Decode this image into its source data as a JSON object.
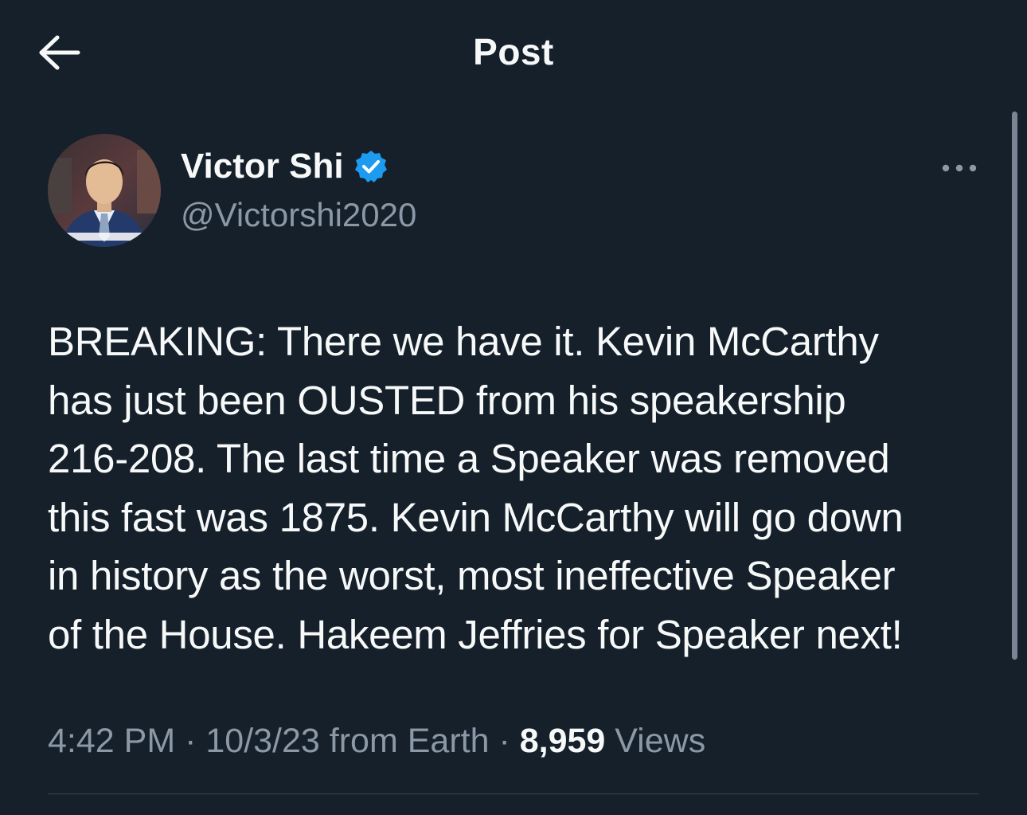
{
  "header": {
    "title": "Post",
    "back_icon": "arrow-left-icon"
  },
  "author": {
    "display_name": "Victor Shi",
    "handle": "@Victorshi2020",
    "verified_icon": "verified-badge-icon",
    "more_icon": "more-horizontal-icon"
  },
  "tweet": {
    "text": "BREAKING: There we have it. Kevin McCarthy\nhas just been OUSTED from his speakership\n216-208. The last time a Speaker was removed\nthis fast was 1875. Kevin McCarthy will go down\nin history as the worst, most ineffective Speaker\nof the House. Hakeem Jeffries for Speaker next!"
  },
  "meta": {
    "time": "4:42 PM",
    "separator": " · ",
    "date_source": "10/3/23 from Earth",
    "views_count": "8,959",
    "views_label": " Views"
  },
  "colors": {
    "background": "#15202b",
    "text": "#f7f9f9",
    "secondary": "#8b98a5",
    "verified": "#1d9bf0"
  }
}
